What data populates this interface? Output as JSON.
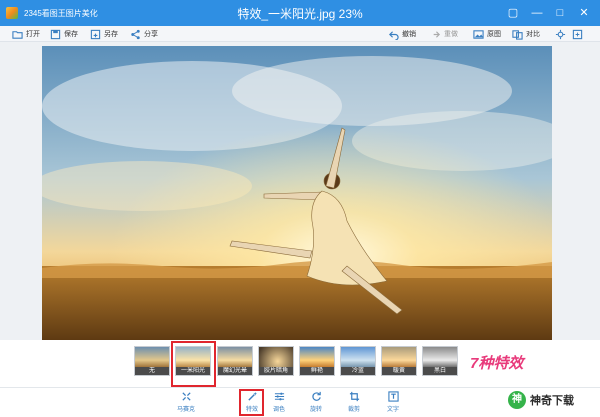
{
  "app": {
    "name": "2345看图王图片美化",
    "window_title": "特效_一米阳光.jpg 23%"
  },
  "window_controls": {
    "skin": "▢",
    "minimize": "—",
    "maximize": "□",
    "close": "✕"
  },
  "toolbar": {
    "open": "打开",
    "save": "保存",
    "save_as": "另存",
    "share": "分享",
    "undo": "撤销",
    "redo": "重做",
    "original": "原图",
    "compare": "对比"
  },
  "filters": [
    {
      "label": "无"
    },
    {
      "label": "一米阳光"
    },
    {
      "label": "魔幻光晕"
    },
    {
      "label": "胶片暗角"
    },
    {
      "label": "鲜艳"
    },
    {
      "label": "冷蓝"
    },
    {
      "label": "暖黄"
    },
    {
      "label": "黑白"
    }
  ],
  "selected_filter": "一米阳光",
  "watermark_text": "7种特效",
  "bottom_tools": {
    "mosaic": "马赛克",
    "effects": "特效",
    "adjust": "调色",
    "rotate": "旋转",
    "crop": "裁剪",
    "text": "文字"
  },
  "brand": {
    "logo": "神",
    "text": "神奇下载"
  },
  "colors": {
    "titlebar": "#2f8fe3",
    "accent": "#3a7fc1",
    "highlight": "#e0262e"
  }
}
